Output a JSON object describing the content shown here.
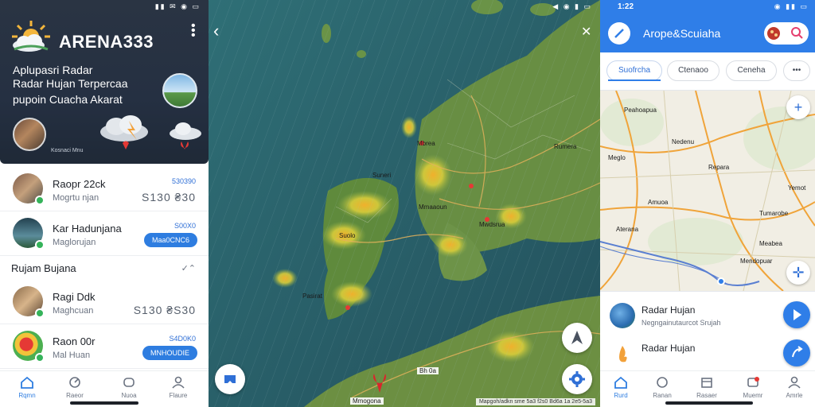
{
  "left": {
    "status_icons": "▮▮ ✉ ◉ ▭",
    "brand": "ARENA333",
    "menu_icon": "kebab-icon",
    "hero_lines": [
      "Aplupasri Radar",
      "Radar Hujan Terpercaa",
      "pupoin Cuacha Akarat"
    ],
    "hero_caption": "Kosnaci Mnu",
    "rows": [
      {
        "title": "Raopr 22ck",
        "subtitle": "Mogrtu njan",
        "meta_top": "530390",
        "meta_bottom": "S130 ₴30",
        "avatar": "house-thumb"
      },
      {
        "title": "Kar Hadunjana",
        "subtitle": "Maglorujan",
        "meta_top": "S00X0",
        "pill": "Maa0CNC6",
        "avatar": "tower-thumb"
      }
    ],
    "section": {
      "title": "Rujam Bujana",
      "action": "✓⌃"
    },
    "rows2": [
      {
        "title": "Ragi Ddk",
        "subtitle": "Maghcuan",
        "meta_top": "",
        "meta_bottom": "S130 ₴S30",
        "avatar": "room-thumb"
      },
      {
        "title": "Raon 00r",
        "subtitle": "Mal Huan",
        "meta_top": "S4D0K0",
        "pill": "MNHOUDIE",
        "avatar": "radar-thumb"
      }
    ],
    "nav": [
      {
        "label": "Rqmn",
        "icon": "home-icon",
        "active": true
      },
      {
        "label": "Raeor",
        "icon": "radar-icon",
        "active": false
      },
      {
        "label": "Nuoa",
        "icon": "cloud-icon",
        "active": false
      },
      {
        "label": "Flaure",
        "icon": "profile-icon",
        "active": false
      }
    ]
  },
  "middle": {
    "status_icons": "◀ ◉ ▮ ▭",
    "close": "✕",
    "labels": [
      "Mbrea",
      "Suneri",
      "Suolo",
      "Mmaaoun",
      "Rumera",
      "Pasirat",
      "Mwdsrua"
    ],
    "bottom_label": "Mmogona",
    "pin_label": "Bh 0a",
    "attribution": "Mapgoh/adkn sme 5a3 f2s0 Bd6a 1a 2e5-5a3"
  },
  "right": {
    "time": "1:22",
    "status_icons": "◉ ▮▮ ▭",
    "title": "Arope&Scuiaha",
    "tabs": [
      "Suofrcha",
      "Ctenaoo",
      "Ceneha",
      "•••"
    ],
    "map_labels": [
      "Peahoapua",
      "Nedenu",
      "Repara",
      "Meglo",
      "Amuoa",
      "Tumarobe",
      "Aterana",
      "Meabea",
      "Mendopuar",
      "Yemot"
    ],
    "items": [
      {
        "title": "Radar Hujan",
        "subtitle": "Negngainutaurcot Srujah",
        "icon": "globe-icon"
      },
      {
        "title": "Radar Hujan",
        "subtitle": "",
        "icon": "flame-icon"
      }
    ],
    "nav": [
      {
        "label": "Rurd",
        "icon": "home-icon",
        "active": true
      },
      {
        "label": "Ranan",
        "icon": "radar-icon",
        "active": false
      },
      {
        "label": "Rasaer",
        "icon": "calendar-icon",
        "active": false
      },
      {
        "label": "Muemr",
        "icon": "alert-icon",
        "active": false
      },
      {
        "label": "Amrle",
        "icon": "profile-icon",
        "active": false
      }
    ]
  },
  "colors": {
    "accent": "#2f7ee8",
    "brand_dark": "#253042",
    "map_sea": "#2a5a63",
    "radar_yellow": "#e8c640"
  }
}
